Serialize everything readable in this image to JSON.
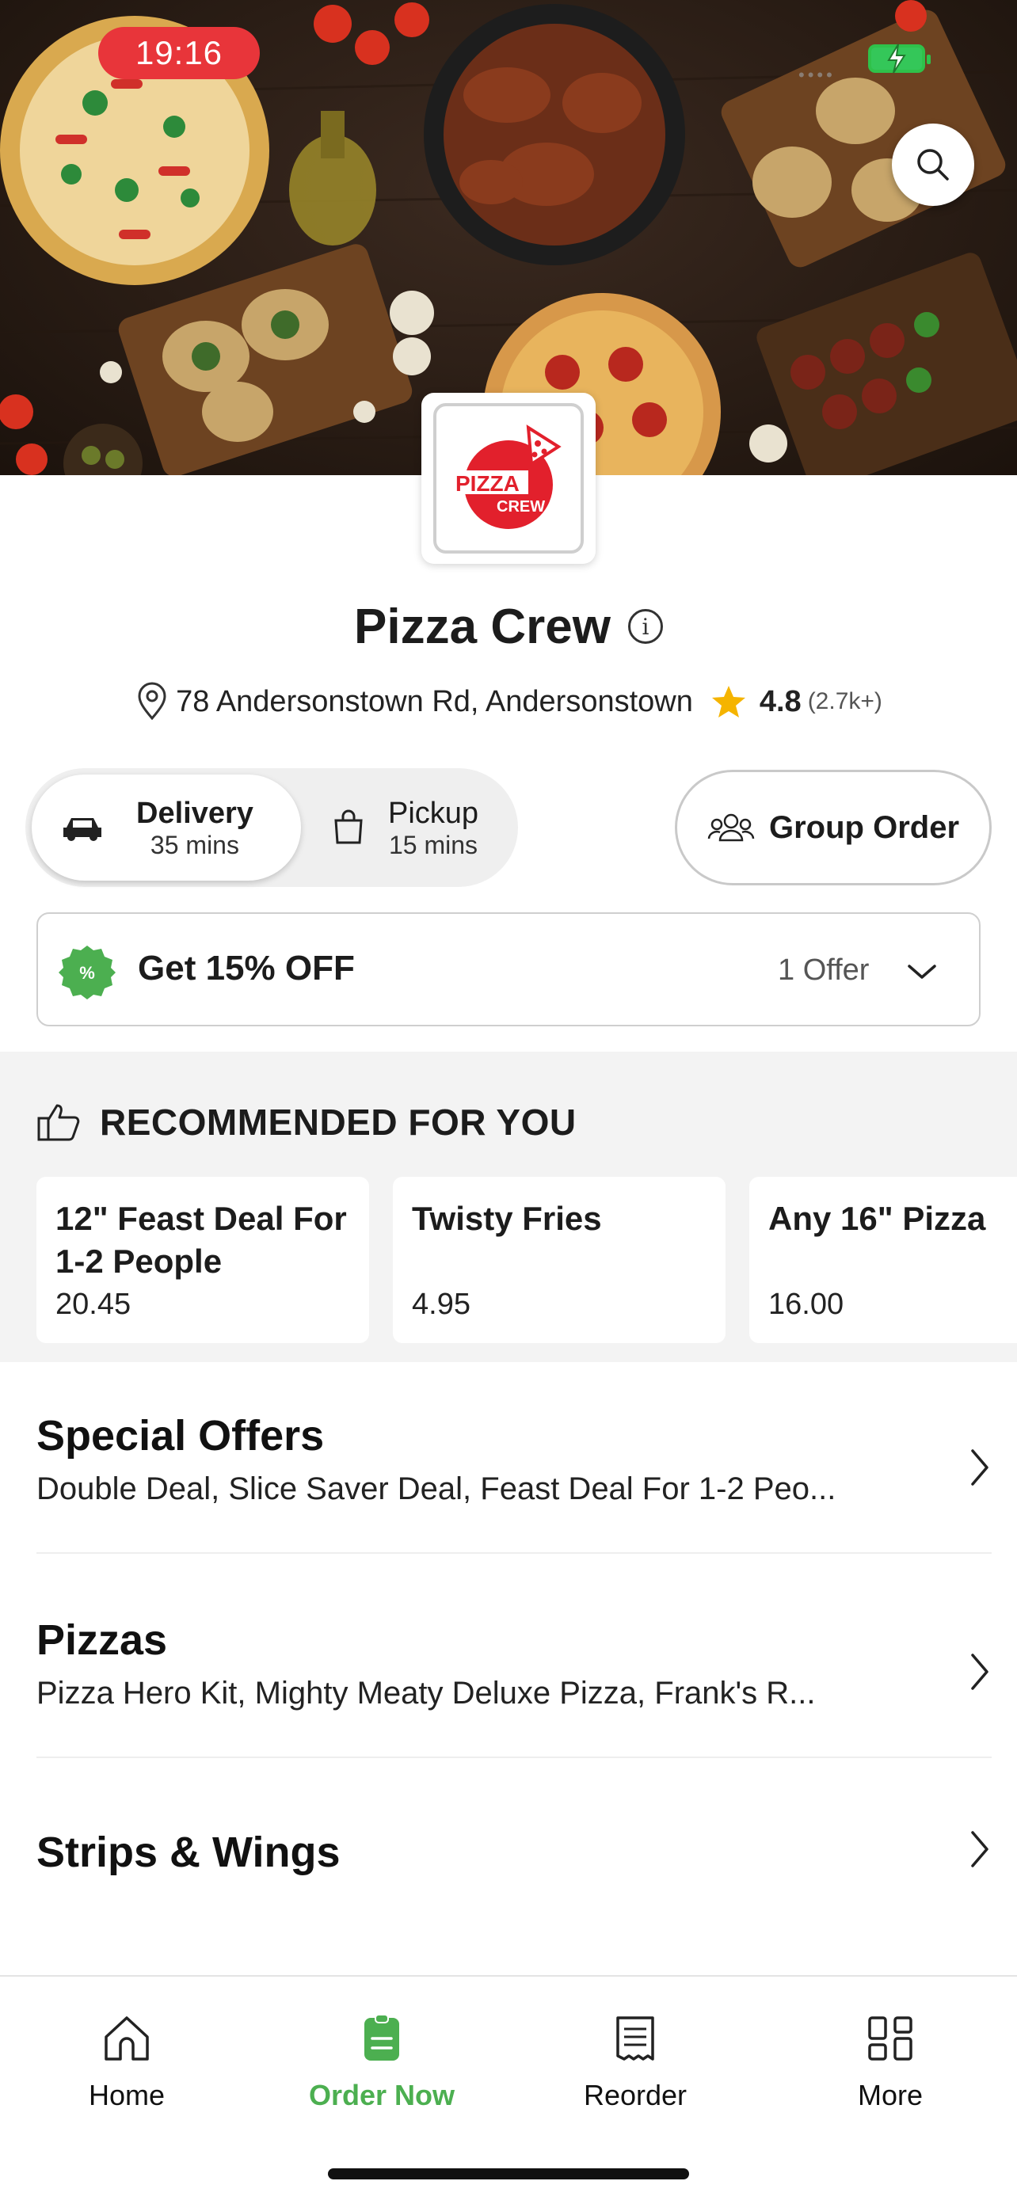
{
  "status_bar": {
    "time": "19:16"
  },
  "colors": {
    "accent": "#4caf50",
    "time_pill": "#e8353a",
    "star": "#f5b400",
    "brand_red": "#e2202c"
  },
  "restaurant": {
    "name": "Pizza Crew",
    "logo_text_1": "PIZZA",
    "logo_text_2": "CREW",
    "address": "78 Andersonstown Rd, Andersonstown",
    "rating": "4.8",
    "rating_count": "(2.7k+)"
  },
  "order_modes": {
    "delivery": {
      "label": "Delivery",
      "time": "35 mins"
    },
    "pickup": {
      "label": "Pickup",
      "time": "15 mins"
    },
    "group_order_label": "Group Order"
  },
  "offer": {
    "title": "Get 15% OFF",
    "count": "1 Offer"
  },
  "recommended": {
    "heading": "RECOMMENDED FOR YOU",
    "items": [
      {
        "name": "12\" Feast Deal For 1-2 People",
        "price": "20.45"
      },
      {
        "name": "Twisty Fries",
        "price": "4.95"
      },
      {
        "name": "Any 16\" Pizza",
        "price": "16.00"
      }
    ]
  },
  "categories": [
    {
      "name": "Special Offers",
      "description": "Double Deal, Slice Saver Deal, Feast Deal For 1-2 Peo..."
    },
    {
      "name": "Pizzas",
      "description": "Pizza Hero Kit, Mighty Meaty Deluxe Pizza, Frank's R..."
    },
    {
      "name": "Strips & Wings",
      "description": ""
    }
  ],
  "tabbar": [
    {
      "label": "Home",
      "icon": "home-icon"
    },
    {
      "label": "Order Now",
      "icon": "order-icon",
      "active": true
    },
    {
      "label": "Reorder",
      "icon": "receipt-icon"
    },
    {
      "label": "More",
      "icon": "grid-icon"
    }
  ]
}
